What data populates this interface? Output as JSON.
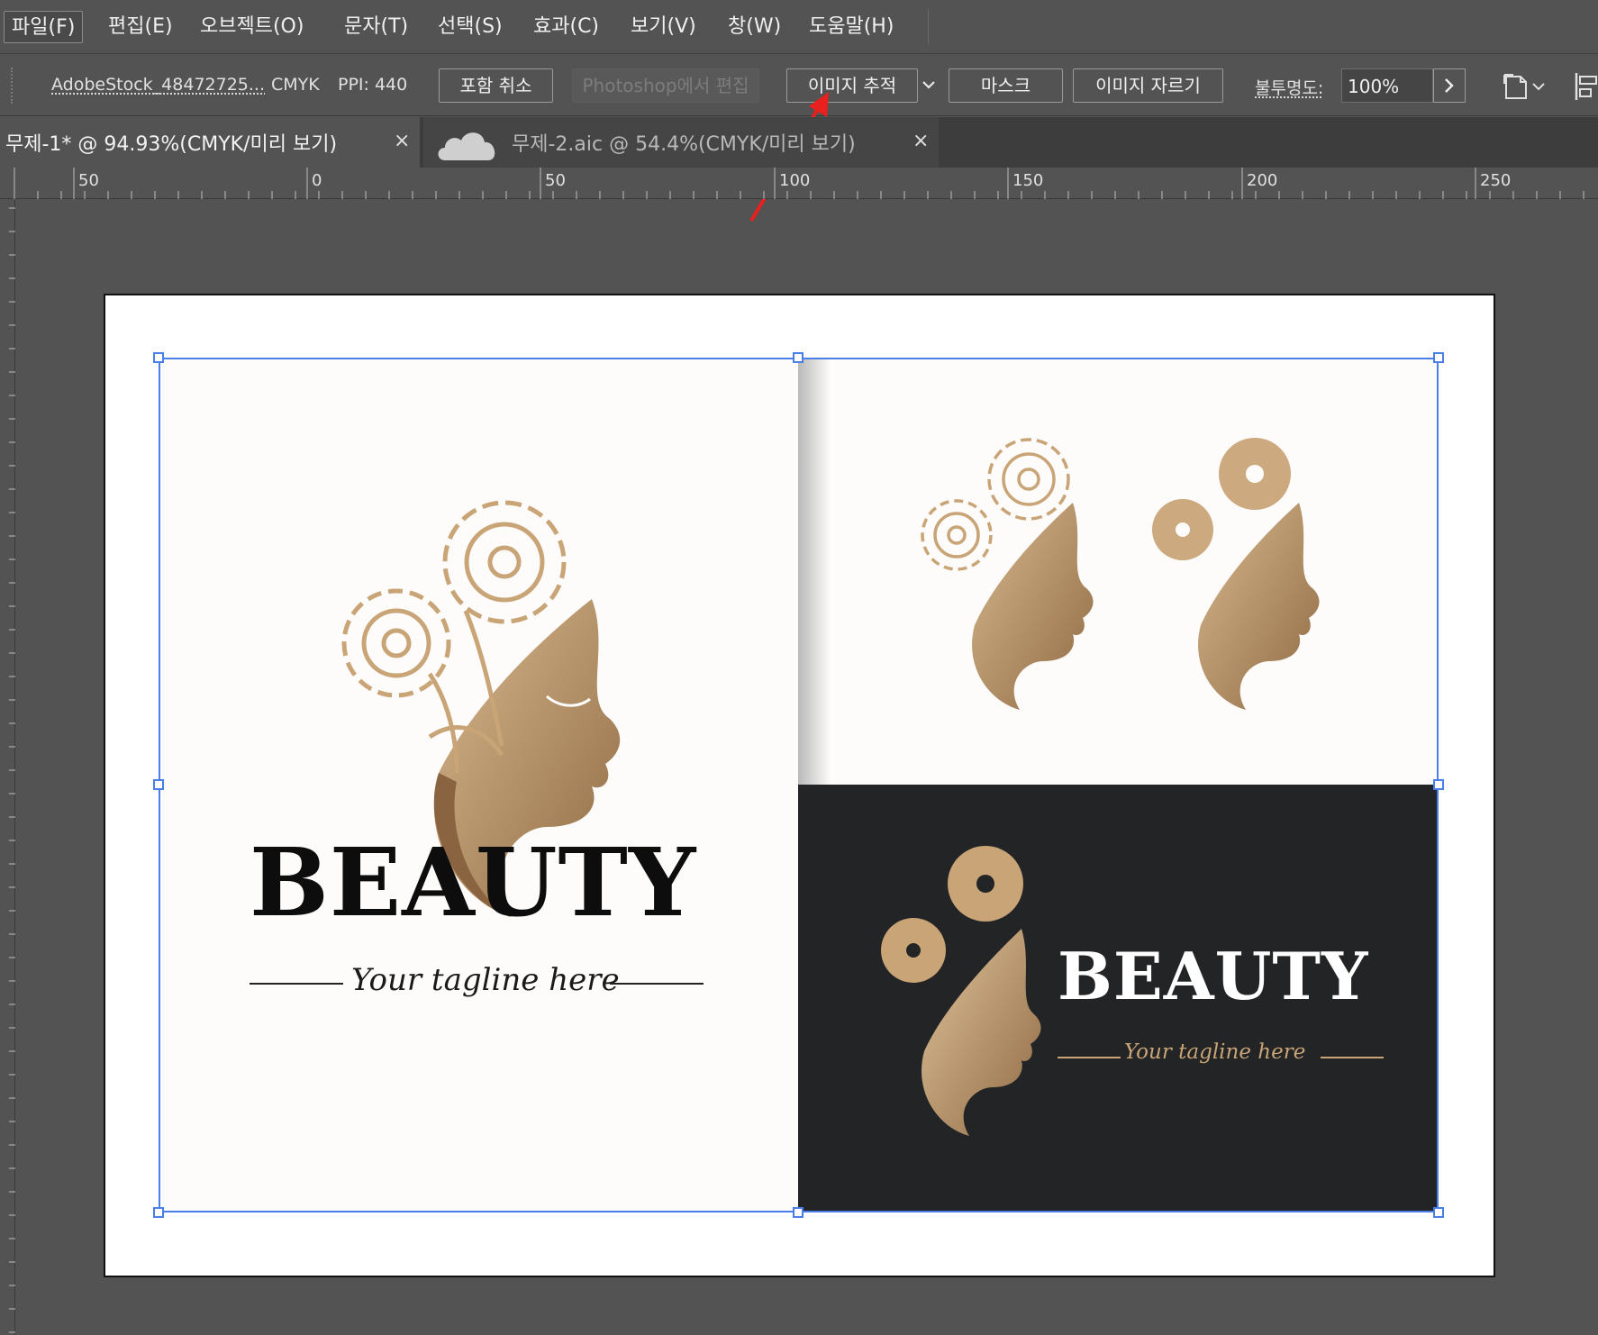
{
  "menubar": {
    "items": [
      "파일(F)",
      "편집(E)",
      "오브젝트(O)",
      "문자(T)",
      "선택(S)",
      "효과(C)",
      "보기(V)",
      "창(W)",
      "도움말(H)"
    ]
  },
  "controlbar": {
    "file_name": "AdobeStock_48472725...",
    "color_mode": "CMYK",
    "ppi": "PPI: 440",
    "unembed_button": "포함 취소",
    "edit_photoshop_button": "Photoshop에서 편집",
    "image_trace_button": "이미지 추적",
    "mask_button": "마스크",
    "crop_button": "이미지 자르기",
    "opacity_label": "불투명도:",
    "opacity_value": "100%"
  },
  "tabs": [
    {
      "title": "무제-1*  @  94.93%(CMYK/미리 보기)",
      "close": "×"
    },
    {
      "title": "무제-2.aic  @  54.4%(CMYK/미리 보기)",
      "close": "×"
    }
  ],
  "ruler": {
    "labels": [
      "50",
      "0",
      "50",
      "100",
      "150",
      "200",
      "250"
    ]
  },
  "artwork": {
    "wordmark_main": "BEAUTY",
    "tagline_main": "Your tagline here",
    "wordmark_dark": "BEAUTY",
    "tagline_dark": "Your tagline here"
  },
  "colors": {
    "gold": "#c19a6b",
    "gold_dark": "#9c7650",
    "selection": "#4a7ee8",
    "annotation_arrow": "#e8201e",
    "dark_panel": "#232425"
  },
  "icons": {
    "cloud": "cloud-icon",
    "document_setup": "document-setup-icon",
    "align": "align-icon",
    "chevron_down": "chevron-down-icon",
    "chevron_right": "chevron-right-icon"
  }
}
